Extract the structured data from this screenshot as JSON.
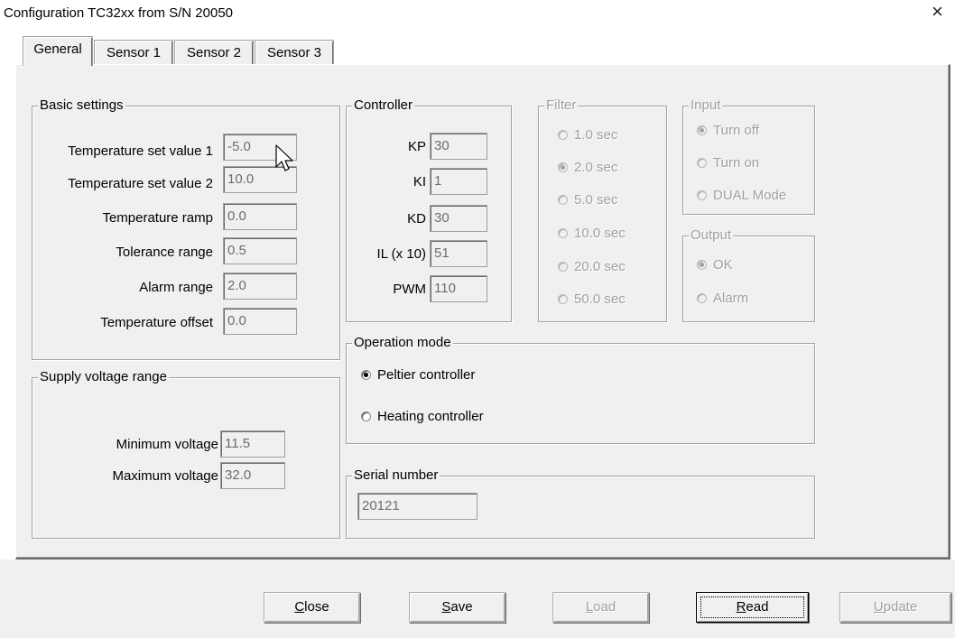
{
  "window": {
    "title": "Configuration TC32xx from S/N 20050",
    "close_glyph": "×"
  },
  "tabs": [
    {
      "label": "General",
      "active": true
    },
    {
      "label": "Sensor 1",
      "active": false
    },
    {
      "label": "Sensor 2",
      "active": false
    },
    {
      "label": "Sensor 3",
      "active": false
    }
  ],
  "basic_settings": {
    "title": "Basic settings",
    "fields": [
      {
        "label": "Temperature set value 1",
        "value": "-5.0"
      },
      {
        "label": "Temperature set value 2",
        "value": "10.0"
      },
      {
        "label": "Temperature ramp",
        "value": "0.0"
      },
      {
        "label": "Tolerance range",
        "value": "0.5"
      },
      {
        "label": "Alarm range",
        "value": "2.0"
      },
      {
        "label": "Temperature offset",
        "value": "0.0"
      }
    ]
  },
  "supply_voltage": {
    "title": "Supply voltage range",
    "fields": [
      {
        "label": "Minimum voltage",
        "value": "11.5"
      },
      {
        "label": "Maximum voltage",
        "value": "32.0"
      }
    ]
  },
  "controller": {
    "title": "Controller",
    "fields": [
      {
        "label": "KP",
        "value": "30"
      },
      {
        "label": "KI",
        "value": "1"
      },
      {
        "label": "KD",
        "value": "30"
      },
      {
        "label": "IL (x 10)",
        "value": "51"
      },
      {
        "label": "PWM",
        "value": "110"
      }
    ]
  },
  "filter": {
    "title": "Filter",
    "options": [
      "1.0 sec",
      "2.0 sec",
      "5.0 sec",
      "10.0 sec",
      "20.0 sec",
      "50.0 sec"
    ],
    "selected": "2.0 sec"
  },
  "input": {
    "title": "Input",
    "options": [
      "Turn off",
      "Turn on",
      "DUAL Mode"
    ],
    "selected": "Turn off"
  },
  "output": {
    "title": "Output",
    "options": [
      "OK",
      "Alarm"
    ],
    "selected": "OK"
  },
  "operation_mode": {
    "title": "Operation mode",
    "options": [
      "Peltier controller",
      "Heating controller"
    ],
    "selected": "Peltier controller"
  },
  "serial": {
    "title": "Serial number",
    "value": "20121"
  },
  "buttons": {
    "close": {
      "label": "Close",
      "mnemonic": "C",
      "rest": "lose",
      "enabled": true
    },
    "save": {
      "label": "Save",
      "mnemonic": "S",
      "rest": "ave",
      "enabled": true
    },
    "load": {
      "label": "Load",
      "mnemonic": "L",
      "rest": "oad",
      "enabled": false
    },
    "read": {
      "label": "Read",
      "mnemonic": "R",
      "rest": "ead",
      "enabled": true
    },
    "update": {
      "label": "Update",
      "mnemonic": "U",
      "rest": "pdate",
      "enabled": false
    }
  },
  "colors": {
    "face": "#f0f0f0",
    "disabled_text": "#a0a0a0",
    "field_text": "#6d6d6d"
  },
  "icons": {
    "cursor": "arrow-cursor-icon",
    "close": "close-icon"
  }
}
